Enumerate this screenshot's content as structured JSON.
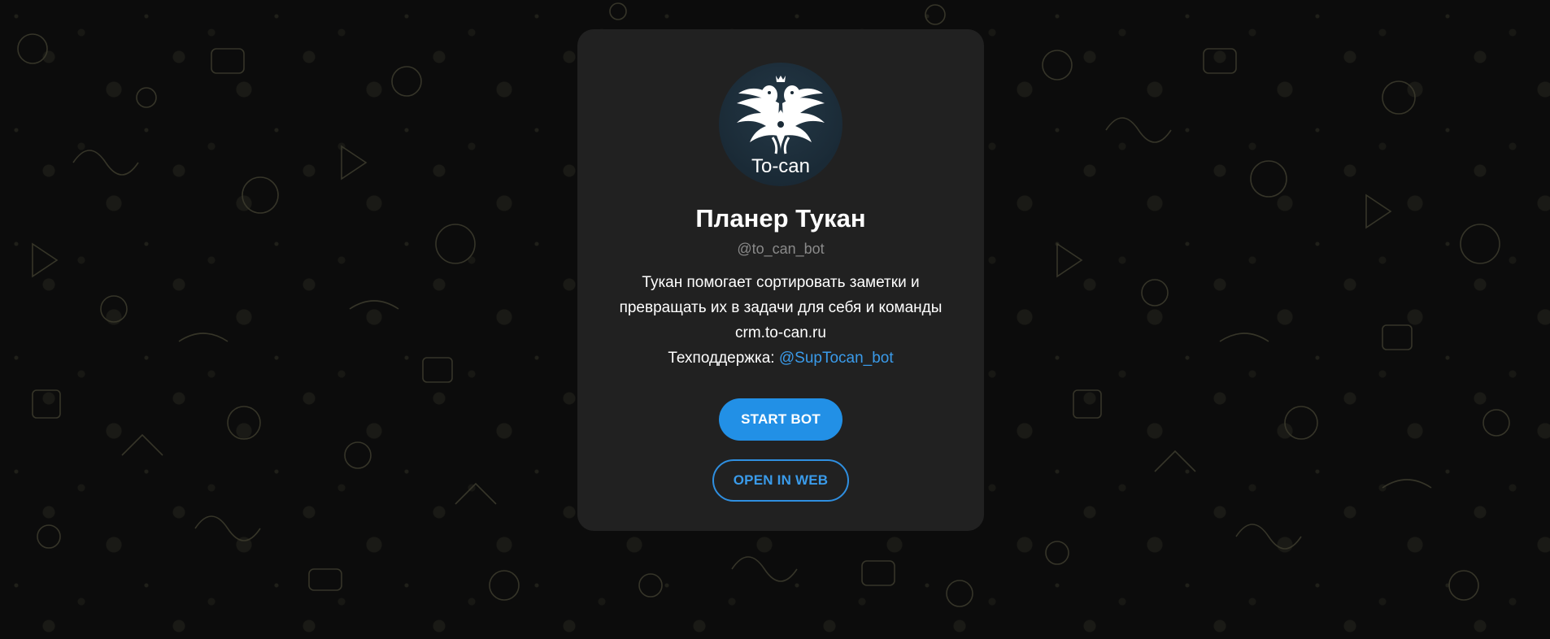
{
  "bot": {
    "avatar_text": "To-can",
    "title": "Планер Тукан",
    "username": "@to_can_bot",
    "description_line1": "Тукан помогает сортировать заметки и",
    "description_line2": "превращать их в задачи для себя и команды",
    "description_line3": "crm.to-can.ru",
    "support_label": "Техподдержка:",
    "support_link": "@SupTocan_bot"
  },
  "actions": {
    "start_label": "START BOT",
    "web_label": "OPEN IN WEB"
  },
  "colors": {
    "card_bg": "#212121",
    "accent": "#2290e6",
    "link": "#3a9bea",
    "muted": "#8a8a8a"
  },
  "icons": {
    "avatar": "toucan-logo-icon",
    "background": "doodle-pattern"
  }
}
